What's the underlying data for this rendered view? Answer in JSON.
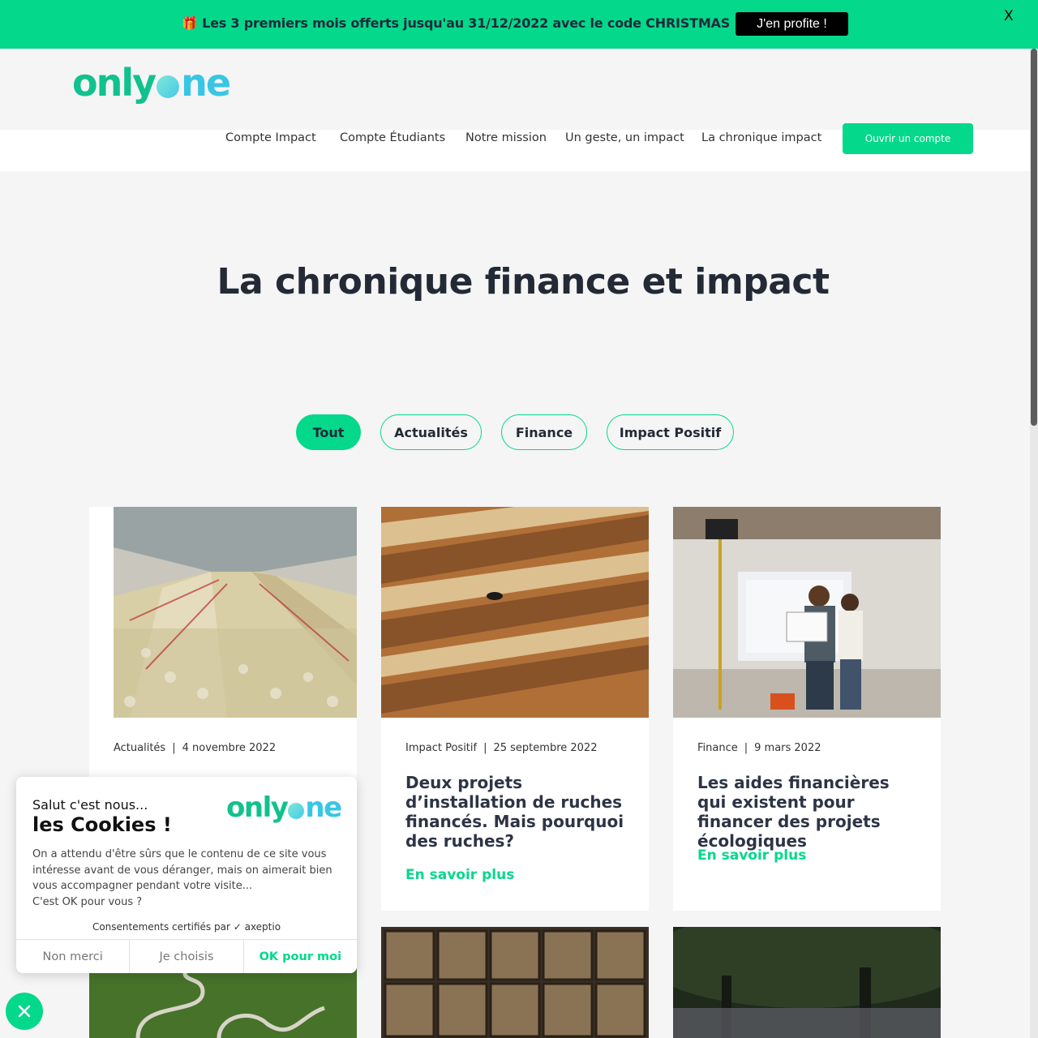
{
  "promo": {
    "text": "🎁 Les 3 premiers mois offerts jusqu'au 31/12/2022 avec le code CHRISTMAS 🎁",
    "cta": "J'en profite !",
    "close": "X"
  },
  "logo": {
    "part1": "only",
    "part2": "ne"
  },
  "nav": {
    "items": [
      "Compte Impact",
      "Compte Étudiants",
      "Notre mission",
      "Un geste, un impact",
      "La chronique impact"
    ],
    "cta": "Ouvrir un compte"
  },
  "page_title": "La chronique finance et impact",
  "filters": [
    "Tout",
    "Actualités",
    "Finance",
    "Impact Positif"
  ],
  "cards": [
    {
      "category": "Actualités",
      "date": "4 novembre 2022",
      "title": "",
      "link": ""
    },
    {
      "category": "Impact Positif",
      "date": "25 septembre 2022",
      "title": "Deux projets d’installation de ruches financés. Mais pourquoi des ruches?",
      "link": "En savoir plus"
    },
    {
      "category": "Finance",
      "date": "9 mars 2022",
      "title": "Les aides financières qui existent pour financer des projets écologiques",
      "link": "En savoir plus"
    }
  ],
  "cookie": {
    "hello": "Salut c'est nous...",
    "title": "les Cookies !",
    "body": "On a attendu d'être sûrs que le contenu de ce site vous intéresse avant de vous déranger, mais on aimerait bien vous accompagner pendant votre visite...",
    "question": "C'est OK pour vous ?",
    "certified": "Consentements certifiés par ✓ axeptio",
    "buttons": [
      "Non merci",
      "Je choisis",
      "OK pour moi"
    ]
  },
  "colors": {
    "accent": "#03d88b",
    "dark": "#232a36"
  }
}
